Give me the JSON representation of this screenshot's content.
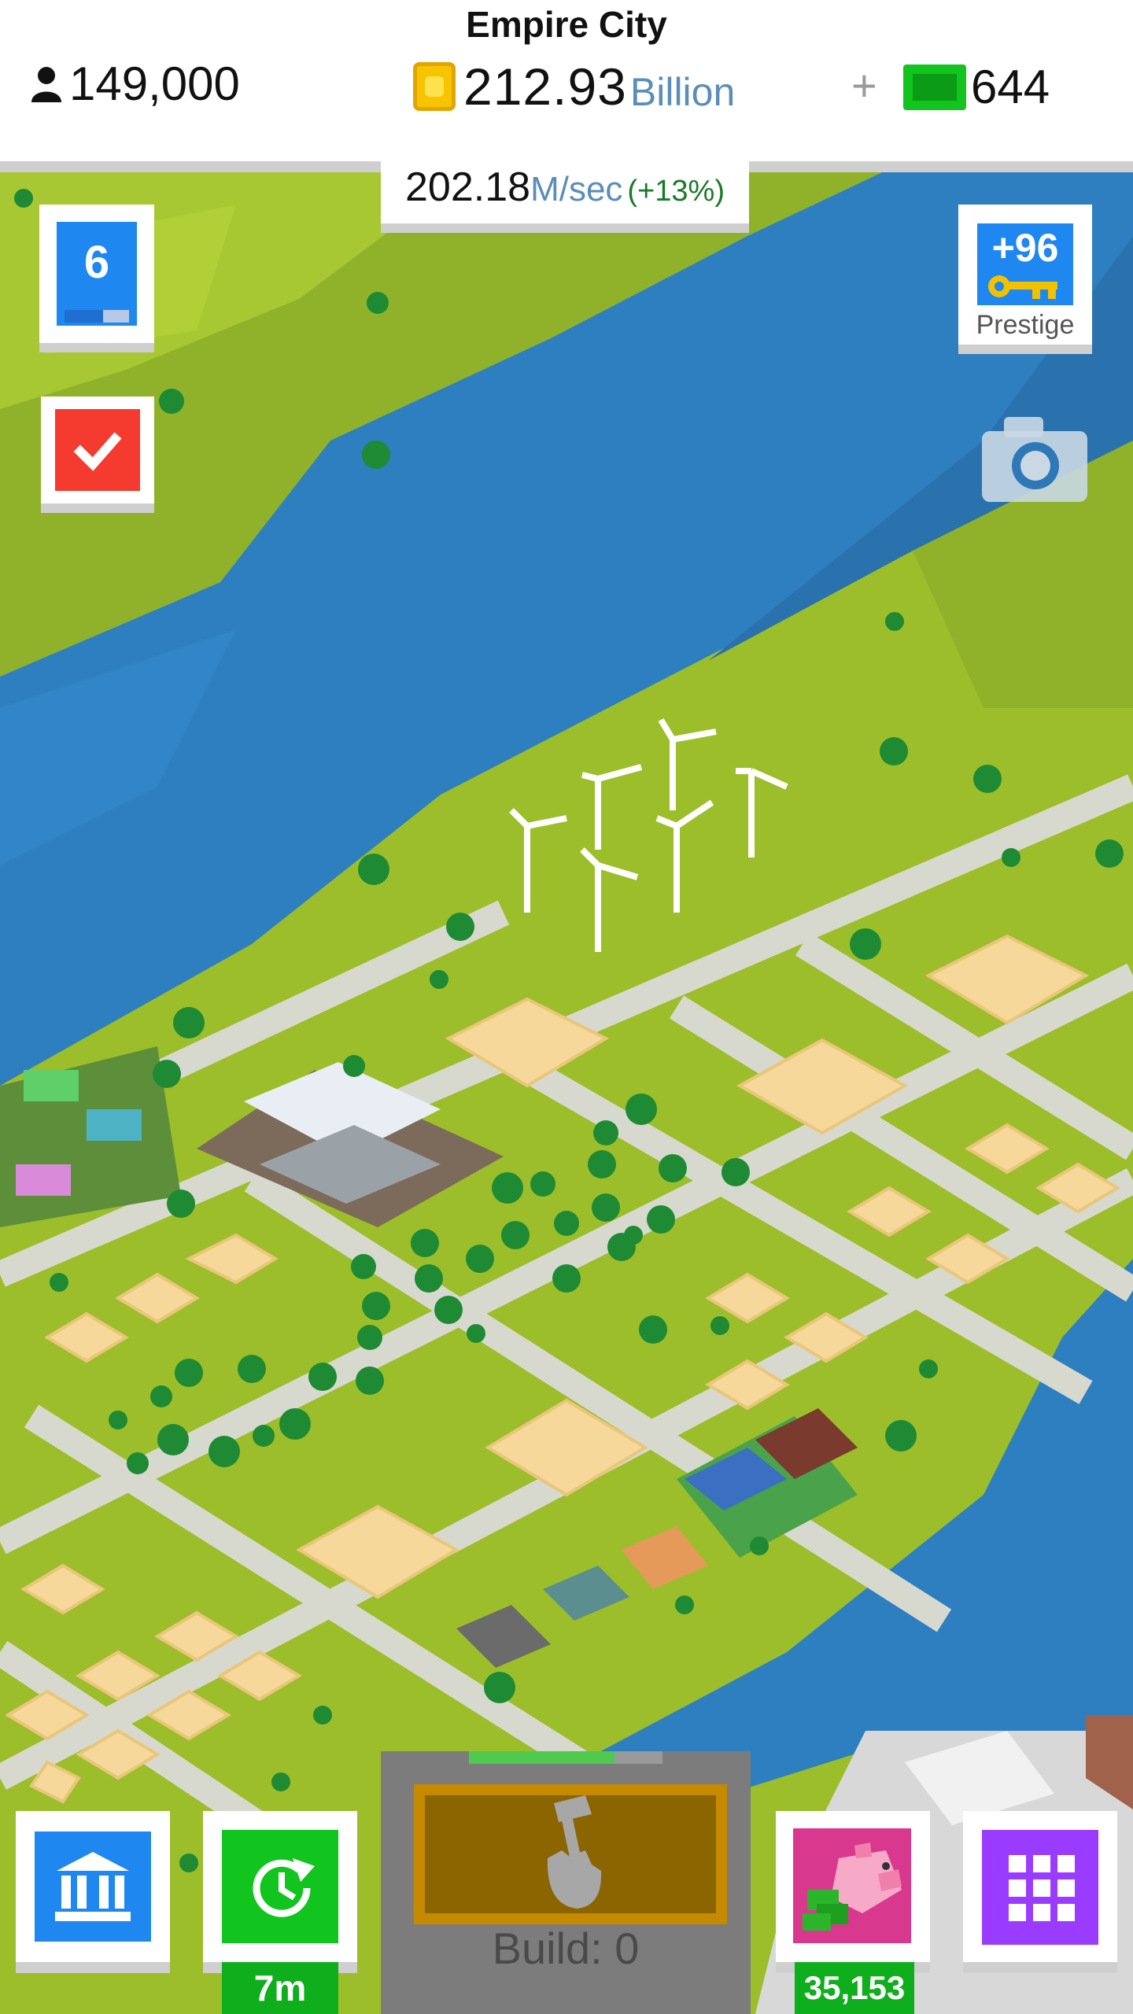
{
  "header": {
    "city_name": "Empire City",
    "population": "149,000",
    "money_amount": "212.93",
    "money_unit": "Billion",
    "add_label": "+",
    "cash": "644"
  },
  "income": {
    "value": "202.18",
    "unit": "M/sec",
    "bonus": "(+13%)"
  },
  "level": {
    "number": "6",
    "progress": 0.6
  },
  "prestige": {
    "keys": "+96",
    "label": "Prestige"
  },
  "build": {
    "label": "Build: 0",
    "progress": 0.75
  },
  "timer": {
    "label": "7m"
  },
  "piggy_bank": {
    "value": "35,153"
  },
  "colors": {
    "blue_button": "#1e88f0",
    "green_button": "#11c41e",
    "red_button": "#f53a2f",
    "pink_button": "#d9388f",
    "purple_button": "#9a3cff",
    "water": "#2e7fc0",
    "grass": "#9cbe2b"
  },
  "icons": {
    "population": "person-icon",
    "money": "coin-icon",
    "cash": "banknote-icon",
    "tasks": "checkmark-icon",
    "prestige": "key-icon",
    "screenshot": "camera-icon",
    "bank": "bank-icon",
    "timer": "clock-icon",
    "build": "hammer-hand-icon",
    "piggy_bank": "piggy-bank-icon",
    "menu": "grid-icon"
  }
}
